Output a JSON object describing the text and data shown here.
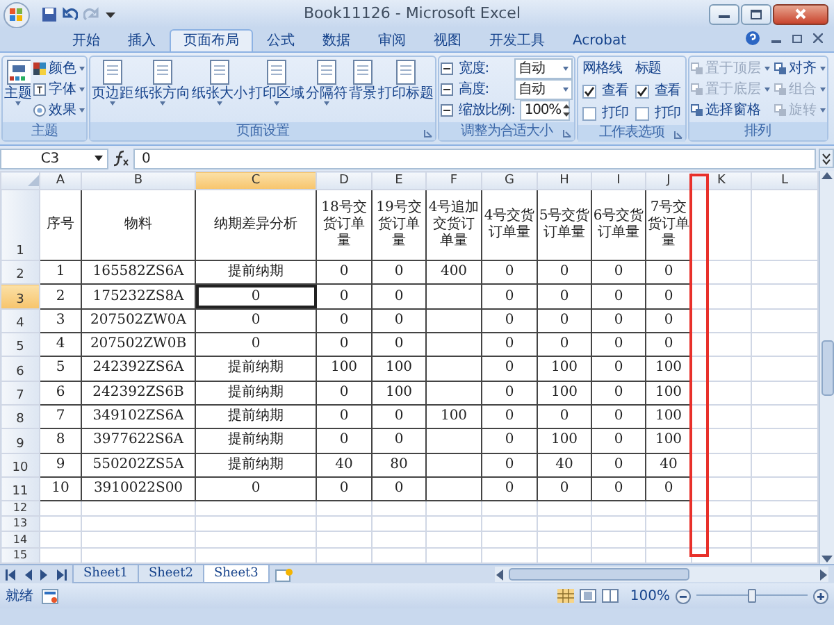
{
  "window": {
    "title": "Book11126 - Microsoft Excel"
  },
  "ribbon_tabs": [
    {
      "label": "开始",
      "selected": false
    },
    {
      "label": "插入",
      "selected": false
    },
    {
      "label": "页面布局",
      "selected": true
    },
    {
      "label": "公式",
      "selected": false
    },
    {
      "label": "数据",
      "selected": false
    },
    {
      "label": "审阅",
      "selected": false
    },
    {
      "label": "视图",
      "selected": false
    },
    {
      "label": "开发工具",
      "selected": false
    },
    {
      "label": "Acrobat",
      "selected": false
    }
  ],
  "ribbon_groups": [
    {
      "kind": "themes",
      "title": "主题",
      "launcher": false,
      "large": {
        "label": "主题"
      },
      "items": [
        {
          "label": "颜色"
        },
        {
          "label": "字体"
        },
        {
          "label": "效果"
        }
      ]
    },
    {
      "kind": "buttons",
      "title": "页面设置",
      "launcher": true,
      "buttons": [
        {
          "label": "页边距",
          "dropdown": true
        },
        {
          "label": "纸张方向",
          "dropdown": true
        },
        {
          "label": "纸张大小",
          "dropdown": true
        },
        {
          "label": "打印区域",
          "dropdown": true
        },
        {
          "label": "分隔符",
          "dropdown": true
        },
        {
          "label": "背景",
          "dropdown": false
        },
        {
          "label": "打印标题",
          "dropdown": false
        }
      ]
    },
    {
      "kind": "fields",
      "title": "调整为合适大小",
      "launcher": true,
      "fields": [
        {
          "label": "宽度:",
          "value": "自动",
          "kind": "dropdown"
        },
        {
          "label": "高度:",
          "value": "自动",
          "kind": "dropdown"
        },
        {
          "label": "缩放比例:",
          "value": "100%",
          "kind": "spinner"
        }
      ]
    },
    {
      "kind": "options",
      "title": "工作表选项",
      "launcher": true,
      "columns": [
        {
          "title": "网格线",
          "options": [
            {
              "label": "查看",
              "checked": true
            },
            {
              "label": "打印",
              "checked": false
            }
          ]
        },
        {
          "title": "标题",
          "options": [
            {
              "label": "查看",
              "checked": true
            },
            {
              "label": "打印",
              "checked": false
            }
          ]
        }
      ]
    },
    {
      "kind": "arrange",
      "title": "排列",
      "launcher": false,
      "items": [
        {
          "label": "置于顶层",
          "disabled": true,
          "dropdown": true
        },
        {
          "label": "对齐",
          "disabled": false,
          "dropdown": true
        },
        {
          "label": "置于底层",
          "disabled": true,
          "dropdown": true
        },
        {
          "label": "组合",
          "disabled": true,
          "dropdown": true
        },
        {
          "label": "选择窗格",
          "disabled": false,
          "dropdown": false
        },
        {
          "label": "旋转",
          "disabled": true,
          "dropdown": true
        }
      ]
    }
  ],
  "formula_bar": {
    "name_box": "C3",
    "formula": "0"
  },
  "sheet": {
    "columns": [
      {
        "label": "A",
        "selected": false
      },
      {
        "label": "B",
        "selected": false
      },
      {
        "label": "C",
        "selected": true
      },
      {
        "label": "D",
        "selected": false
      },
      {
        "label": "E",
        "selected": false
      },
      {
        "label": "F",
        "selected": false
      },
      {
        "label": "G",
        "selected": false
      },
      {
        "label": "H",
        "selected": false
      },
      {
        "label": "I",
        "selected": false
      },
      {
        "label": "J",
        "selected": false
      },
      {
        "label": "K",
        "selected": false
      },
      {
        "label": "L",
        "selected": false
      }
    ],
    "rows": [
      {
        "number": "1",
        "selected": false,
        "cells": [
          "序号",
          "物料",
          "纳期差异分析",
          "18号交货订单量",
          "19号交货订单量",
          "4号追加交货订单量",
          "4号交货订单量",
          "5号交货订单量",
          "6号交货订单量",
          "7号交货订单量"
        ]
      },
      {
        "number": "2",
        "selected": false,
        "cells": [
          "1",
          "165582ZS6A",
          "提前纳期",
          "0",
          "0",
          "400",
          "0",
          "0",
          "0",
          "0"
        ]
      },
      {
        "number": "3",
        "selected": true,
        "cells": [
          "2",
          "175232ZS8A",
          "0",
          "0",
          "0",
          null,
          "0",
          "0",
          "0",
          "0"
        ]
      },
      {
        "number": "4",
        "selected": false,
        "cells": [
          "3",
          "207502ZW0A",
          "0",
          "0",
          "0",
          null,
          "0",
          "0",
          "0",
          "0"
        ]
      },
      {
        "number": "5",
        "selected": false,
        "cells": [
          "4",
          "207502ZW0B",
          "0",
          "0",
          "0",
          null,
          "0",
          "0",
          "0",
          "0"
        ]
      },
      {
        "number": "6",
        "selected": false,
        "cells": [
          "5",
          "242392ZS6A",
          "提前纳期",
          "100",
          "100",
          null,
          "0",
          "100",
          "0",
          "100"
        ]
      },
      {
        "number": "7",
        "selected": false,
        "cells": [
          "6",
          "242392ZS6B",
          "提前纳期",
          "0",
          "100",
          null,
          "0",
          "100",
          "0",
          "100"
        ]
      },
      {
        "number": "8",
        "selected": false,
        "cells": [
          "7",
          "349102ZS6A",
          "提前纳期",
          "0",
          "0",
          "100",
          "0",
          "0",
          "0",
          "100"
        ]
      },
      {
        "number": "9",
        "selected": false,
        "cells": [
          "8",
          "3977622S6A",
          "提前纳期",
          "0",
          "0",
          null,
          "0",
          "100",
          "0",
          "100"
        ]
      },
      {
        "number": "10",
        "selected": false,
        "cells": [
          "9",
          "550202ZS5A",
          "提前纳期",
          "40",
          "80",
          null,
          "0",
          "40",
          "0",
          "40"
        ]
      },
      {
        "number": "11",
        "selected": false,
        "cells": [
          "10",
          "3910022S00",
          "0",
          "0",
          "0",
          null,
          "0",
          "0",
          "0",
          "0"
        ]
      }
    ],
    "empty_rows": [
      "12",
      "13",
      "14",
      "15"
    ]
  },
  "annotation": {
    "kind": "highlight-frame"
  },
  "sheet_tabs": [
    {
      "label": "Sheet1",
      "selected": false
    },
    {
      "label": "Sheet2",
      "selected": false
    },
    {
      "label": "Sheet3",
      "selected": true
    }
  ],
  "status_bar": {
    "status": "就绪",
    "zoom": "100%",
    "zoom_slider": {
      "level": 0.5
    }
  }
}
